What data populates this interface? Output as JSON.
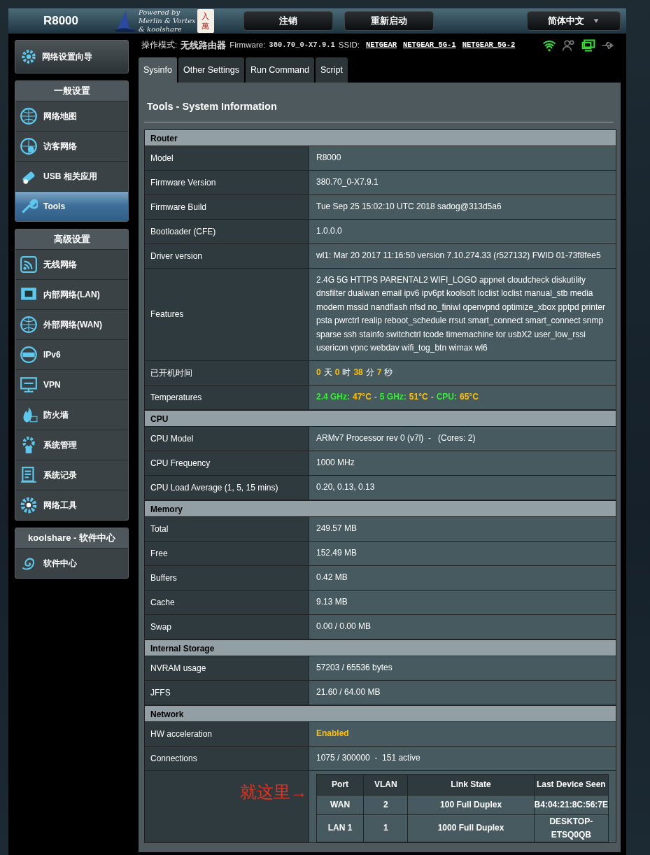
{
  "header": {
    "model": "R8000",
    "logo_lines": [
      "Powered by",
      "Merlin & Vortex",
      "& koolshare"
    ],
    "tile": [
      "入",
      "萬"
    ],
    "buttons": [
      "注销",
      "重新启动"
    ],
    "language": "简体中文"
  },
  "status_line": {
    "mode_label": "操作模式:",
    "mode": "无线路由器",
    "firmware_label": "Firmware:",
    "firmware": "380.70_0-X7.9.1",
    "ssid_label": "SSID:",
    "ssids": [
      "NETGEAR",
      "NETGEAR_5G-1",
      "NETGEAR_5G-2"
    ],
    "indicators": [
      {
        "kind": "wifi",
        "on": true
      },
      {
        "kind": "clients",
        "on": false
      },
      {
        "kind": "network",
        "on": true
      },
      {
        "kind": "usb",
        "on": false
      }
    ]
  },
  "sidebar": {
    "wizard": "网络设置向导",
    "groups": [
      {
        "title": "一般设置",
        "items": [
          {
            "label": "网络地图",
            "selected": false
          },
          {
            "label": "访客网络",
            "selected": false
          },
          {
            "label": "USB 相关应用",
            "selected": false
          },
          {
            "label": "Tools",
            "selected": true
          }
        ]
      },
      {
        "title": "高级设置",
        "items": [
          {
            "label": "无线网络",
            "selected": false
          },
          {
            "label": "内部网络(LAN)",
            "selected": false
          },
          {
            "label": "外部网络(WAN)",
            "selected": false
          },
          {
            "label": "IPv6",
            "selected": false
          },
          {
            "label": "VPN",
            "selected": false
          },
          {
            "label": "防火墙",
            "selected": false
          },
          {
            "label": "系统管理",
            "selected": false
          },
          {
            "label": "系统记录",
            "selected": false
          },
          {
            "label": "网络工具",
            "selected": false
          }
        ]
      },
      {
        "title": "koolshare - 软件中心",
        "items": [
          {
            "label": "软件中心",
            "selected": false
          }
        ]
      }
    ]
  },
  "tabs": [
    {
      "label": "Sysinfo",
      "selected": true
    },
    {
      "label": "Other Settings",
      "selected": false
    },
    {
      "label": "Run Command",
      "selected": false
    },
    {
      "label": "Script",
      "selected": false
    }
  ],
  "panel_title": "Tools - System Information",
  "sections": [
    {
      "title": "Router",
      "rows": [
        {
          "label": "Model",
          "value": "R8000"
        },
        {
          "label": "Firmware Version",
          "value": "380.70_0-X7.9.1"
        },
        {
          "label": "Firmware Build",
          "value": "Tue Sep 25 15:02:10 UTC 2018 sadog@313d5a6"
        },
        {
          "label": "Bootloader (CFE)",
          "value": "1.0.0.0"
        },
        {
          "label": "Driver version",
          "value": "wl1: Mar 20 2017 11:16:50 version 7.10.274.33 (r527132) FWID 01-73f8fee5"
        },
        {
          "label": "Features",
          "value": "2.4G 5G HTTPS PARENTAL2 WIFI_LOGO appnet cloudcheck diskutility dnsfilter dualwan email ipv6 ipv6pt koolsoft loclist loclist manual_stb media modem mssid nandflash nfsd no_finiwl openvpnd optimize_xbox pptpd printer psta pwrctrl realip reboot_schedule rrsut smart_connect smart_connect snmp sparse ssh stainfo switchctrl tcode timemachine tor usbX2 user_low_rssi usericon vpnc webdav wifi_tog_btn wimax wl6"
        },
        {
          "label": "已开机时间",
          "parts": [
            {
              "text": "0",
              "color": "#ffc000"
            },
            {
              "text": "天"
            },
            {
              "text": "0",
              "color": "#ffc000"
            },
            {
              "text": "时"
            },
            {
              "text": "38",
              "color": "#ffc000"
            },
            {
              "text": "分"
            },
            {
              "text": "7",
              "color": "#ffc000"
            },
            {
              "text": "秒"
            }
          ]
        },
        {
          "label": "Temperatures",
          "parts": [
            {
              "text": "2.4 GHz:",
              "color": "#33ee33"
            },
            {
              "text": "47°C",
              "color": "#ffc000"
            },
            {
              "text": "-"
            },
            {
              "text": "5 GHz:",
              "color": "#33ee33"
            },
            {
              "text": "51°C",
              "color": "#ffc000"
            },
            {
              "text": "-"
            },
            {
              "text": "CPU:",
              "color": "#33ee33"
            },
            {
              "text": "65°C",
              "color": "#ffc000"
            }
          ]
        }
      ]
    },
    {
      "title": "CPU",
      "rows": [
        {
          "label": "CPU Model",
          "value": "ARMv7 Processor rev 0 (v7l)  -   (Cores: 2)"
        },
        {
          "label": "CPU Frequency",
          "value": "1000 MHz"
        },
        {
          "label": "CPU Load Average (1, 5, 15 mins)",
          "value": "0.20, 0.13, 0.13"
        }
      ]
    },
    {
      "title": "Memory",
      "rows": [
        {
          "label": "Total",
          "value": "249.57 MB"
        },
        {
          "label": "Free",
          "value": "152.49 MB"
        },
        {
          "label": "Buffers",
          "value": "0.42 MB"
        },
        {
          "label": "Cache",
          "value": "9.13 MB"
        },
        {
          "label": "Swap",
          "value": "0.00 / 0.00 MB"
        }
      ]
    },
    {
      "title": "Internal Storage",
      "rows": [
        {
          "label": "NVRAM usage",
          "value": "57203 / 65536 bytes"
        },
        {
          "label": "JFFS",
          "value": "21.60 / 64.00 MB"
        }
      ]
    },
    {
      "title": "Network",
      "rows": [
        {
          "label": "HW acceleration",
          "parts": [
            {
              "text": "Enabled",
              "color": "#ffc000"
            }
          ]
        },
        {
          "label": "Connections",
          "value": "1075 / 300000  -  151 active"
        }
      ]
    }
  ],
  "annotation": "就这里→",
  "port_table": {
    "columns": [
      "Port",
      "VLAN",
      "Link State",
      "Last Device Seen"
    ],
    "rows": [
      [
        "WAN",
        "2",
        "100 Full Duplex",
        "B4:04:21:8C:56:7E"
      ],
      [
        "LAN 1",
        "1",
        "1000 Full Duplex",
        "DESKTOP-ETSQ0QB"
      ]
    ]
  }
}
